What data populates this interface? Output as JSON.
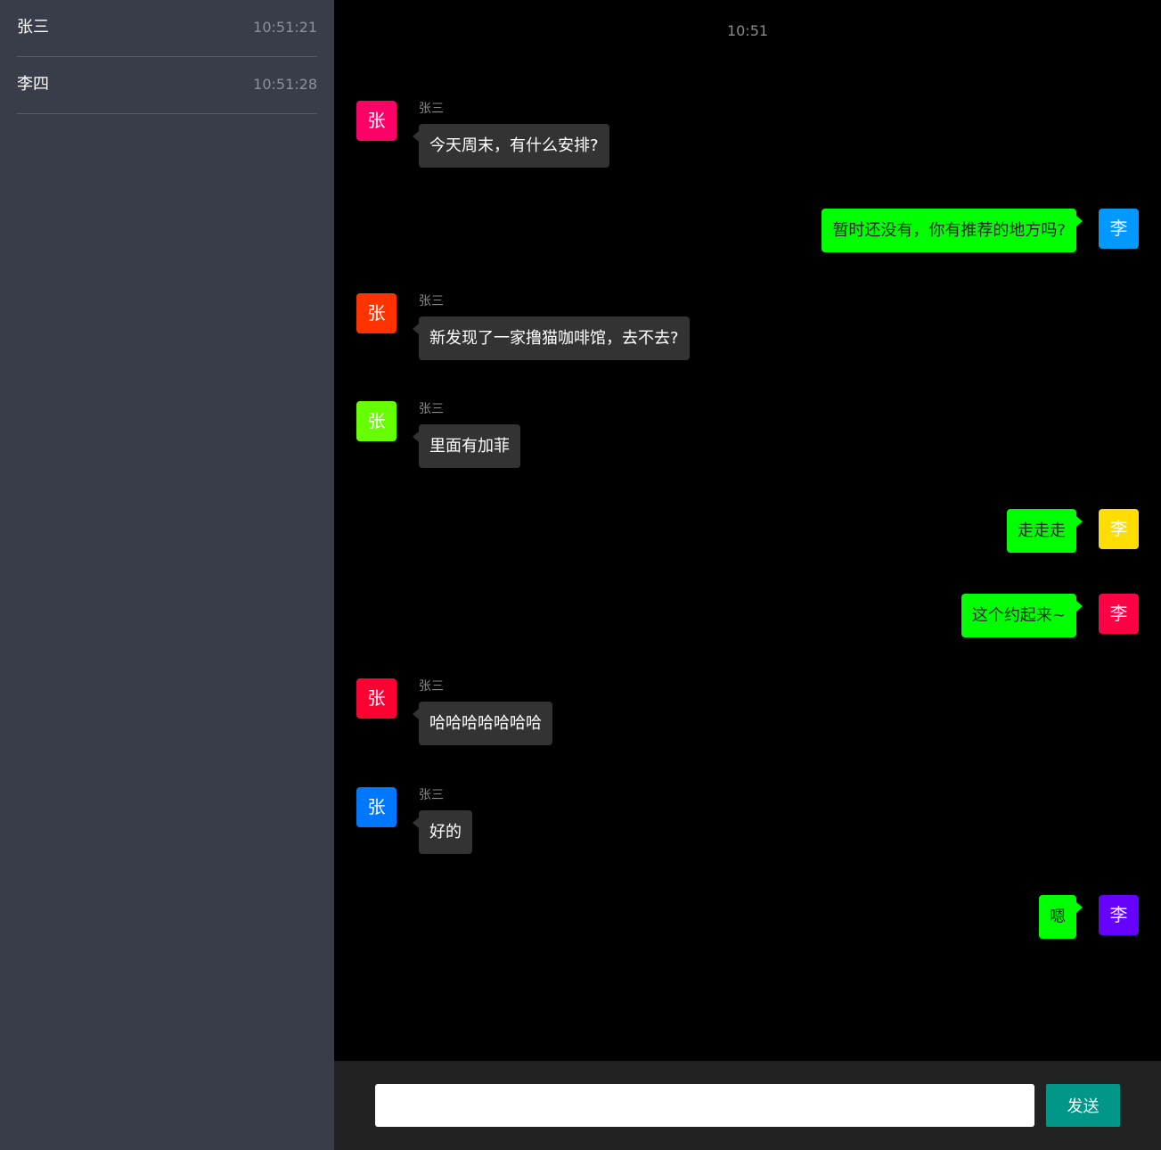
{
  "sidebar": {
    "contacts": [
      {
        "name": "张三",
        "time": "10:51:21"
      },
      {
        "name": "李四",
        "time": "10:51:28"
      }
    ]
  },
  "chat": {
    "time_divider": "10:51",
    "messages": [
      {
        "side": "left",
        "sender": "张三",
        "avatar": "张",
        "avatar_color": "#ff0066",
        "text": "今天周末，有什么安排?"
      },
      {
        "side": "right",
        "avatar": "李",
        "avatar_color": "#0099ff",
        "text": "暂时还没有，你有推荐的地方吗?"
      },
      {
        "side": "left",
        "sender": "张三",
        "avatar": "张",
        "avatar_color": "#ff3300",
        "text": "新发现了一家撸猫咖啡馆，去不去?"
      },
      {
        "side": "left",
        "sender": "张三",
        "avatar": "张",
        "avatar_color": "#66ff00",
        "text": "里面有加菲"
      },
      {
        "side": "right",
        "avatar": "李",
        "avatar_color": "#ffdd00",
        "text": "走走走"
      },
      {
        "side": "right",
        "avatar": "李",
        "avatar_color": "#ff0044",
        "text": "这个约起来~"
      },
      {
        "side": "left",
        "sender": "张三",
        "avatar": "张",
        "avatar_color": "#ff0033",
        "text": "哈哈哈哈哈哈哈"
      },
      {
        "side": "left",
        "sender": "张三",
        "avatar": "张",
        "avatar_color": "#0077ff",
        "text": "好的"
      },
      {
        "side": "right",
        "avatar": "李",
        "avatar_color": "#6600ff",
        "text": "嗯"
      }
    ]
  },
  "input": {
    "value": "",
    "placeholder": "",
    "send_label": "发送"
  }
}
